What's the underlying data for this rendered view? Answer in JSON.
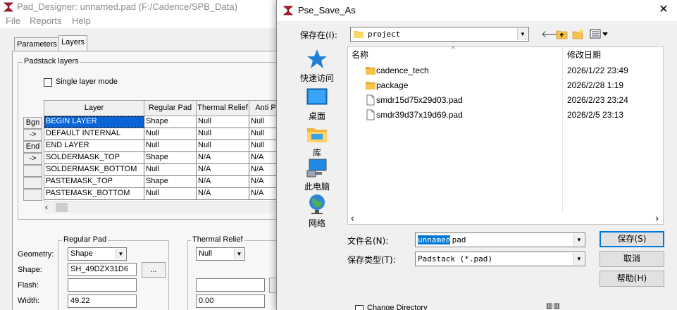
{
  "background_app": {
    "title": "Pad_Designer: unnamed.pad (F:/Cadence/SPB_Data)",
    "menu": [
      "File",
      "Reports",
      "Help"
    ],
    "tabs": [
      "Parameters",
      "Layers"
    ],
    "padstack_group_label": "Padstack layers",
    "single_layer_mode_label": "Single layer mode",
    "grid": {
      "columns": [
        "Layer",
        "Regular Pad",
        "Thermal Relief",
        "Anti P"
      ],
      "rows": [
        [
          "BEGIN LAYER",
          "Shape",
          "Null",
          "Null"
        ],
        [
          "DEFAULT INTERNAL",
          "Null",
          "Null",
          "Null"
        ],
        [
          "END LAYER",
          "Null",
          "Null",
          "Null"
        ],
        [
          "SOLDERMASK_TOP",
          "Shape",
          "N/A",
          "N/A"
        ],
        [
          "SOLDERMASK_BOTTOM",
          "Null",
          "N/A",
          "N/A"
        ],
        [
          "PASTEMASK_TOP",
          "Shape",
          "N/A",
          "N/A"
        ],
        [
          "PASTEMASK_BOTTOM",
          "Null",
          "N/A",
          "N/A"
        ]
      ],
      "row_buttons": [
        "Bgn",
        "->",
        "End",
        "->",
        "",
        "",
        ""
      ]
    },
    "regular_pad": {
      "group_label": "Regular Pad",
      "geometry_label": "Geometry:",
      "geometry_value": "Shape",
      "shape_label": "Shape:",
      "shape_value": "SH_49DZX31D6",
      "browse_label": "...",
      "flash_label": "Flash:",
      "flash_value": "",
      "width_label": "Width:",
      "width_value": "49.22"
    },
    "thermal_relief": {
      "group_label": "Thermal Relief",
      "geometry_value": "Null",
      "width_value": "0.00"
    }
  },
  "dialog": {
    "title": "Pse_Save_As",
    "close_label": "✕",
    "save_in_label": "保存在(I):",
    "save_in_value": "project",
    "places": [
      {
        "label": "快速访问",
        "icon": "star-icon"
      },
      {
        "label": "桌面",
        "icon": "desktop-icon"
      },
      {
        "label": "库",
        "icon": "library-icon"
      },
      {
        "label": "此电脑",
        "icon": "computer-icon"
      },
      {
        "label": "网络",
        "icon": "network-icon"
      }
    ],
    "columns": {
      "name": "名称",
      "date": "修改日期"
    },
    "files": [
      {
        "name": "cadence_tech",
        "date": "2026/1/22 23:49",
        "type": "folder"
      },
      {
        "name": "package",
        "date": "2026/2/28 1:19",
        "type": "folder"
      },
      {
        "name": "smdr15d75x29d03.pad",
        "date": "2026/2/23 23:24",
        "type": "file"
      },
      {
        "name": "smdr39d37x19d69.pad",
        "date": "2026/2/5 23:13",
        "type": "file"
      }
    ],
    "filename_label": "文件名(N):",
    "filename_selected": "unnamed",
    "filename_rest": ".pad",
    "filetype_label": "保存类型(T):",
    "filetype_value": "Padstack (*.pad)",
    "buttons": {
      "save": "保存(S)",
      "cancel": "取消",
      "help": "帮助(H)"
    },
    "change_directory_label": "Change Directory",
    "colors": {
      "selection": "#0a64d7",
      "folder": "#f6c24c",
      "default_button_border": "#0078d7"
    }
  }
}
